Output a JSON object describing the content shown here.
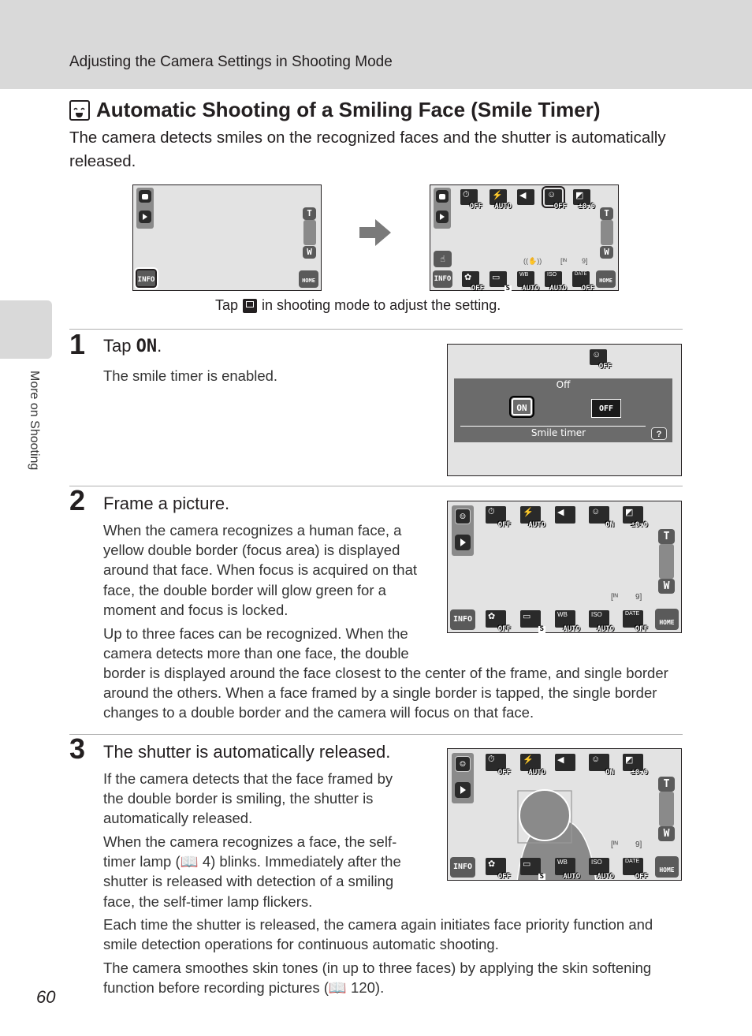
{
  "header": {
    "section": "Adjusting the Camera Settings in Shooting Mode"
  },
  "title": {
    "icon": "smile-timer-icon",
    "text": "Automatic Shooting of a Smiling Face (Smile Timer)"
  },
  "intro": "The camera detects smiles on the recognized faces and the shutter is automatically released.",
  "top_figure": {
    "caption_before": "Tap",
    "caption_icon": "smile-timer-icon",
    "caption_after": "in shooting mode to adjust the setting.",
    "screen_left": {
      "info": "INFO",
      "home": "HOME",
      "zoom_t": "T",
      "zoom_w": "W"
    },
    "screen_right": {
      "top_icons": [
        {
          "name": "self-timer",
          "sub": "OFF"
        },
        {
          "name": "flash",
          "sub": "AUTO"
        },
        {
          "name": "image-mode",
          "sub": ""
        },
        {
          "name": "smile-timer",
          "sub": "OFF"
        },
        {
          "name": "exposure-comp",
          "sub": "±0.0"
        }
      ],
      "bottom_icons": [
        {
          "name": "macro",
          "sub": "OFF"
        },
        {
          "name": "continuous",
          "sub": "S"
        },
        {
          "name": "white-balance",
          "glyph": "WB",
          "sub": "AUTO"
        },
        {
          "name": "iso",
          "glyph": "ISO",
          "sub": "AUTO"
        },
        {
          "name": "date",
          "glyph": "DATE",
          "sub": "OFF"
        }
      ],
      "info": "INFO",
      "home": "HOME",
      "zoom_t": "T",
      "zoom_w": "W",
      "status_vr": "((✋))",
      "status_memory": "[ᴵᴺ",
      "status_count": "9]"
    }
  },
  "steps": [
    {
      "number": "1",
      "title_before": "Tap",
      "title_bold": "ON",
      "title_after": ".",
      "paragraphs": [
        "The smile timer is enabled."
      ],
      "screen": {
        "current": "Off",
        "on_label": "ON",
        "off_label": "OFF",
        "menu_title": "Smile timer",
        "help": "?",
        "icon_sub": "OFF"
      }
    },
    {
      "number": "2",
      "title": "Frame a picture.",
      "paragraphs": [
        "When the camera recognizes a human face, a yellow double border (focus area) is displayed around that face. When focus is acquired on that face, the double border will glow green for a moment and focus is locked.",
        "Up to three faces can be recognized. When the camera detects more than one face, the double",
        "border is displayed around the face closest to the center of the frame, and single border around the others. When a face framed by a single border is tapped, the single border changes to a double border and the camera will focus on that face."
      ],
      "screen": {
        "top_icons": [
          {
            "name": "self-timer",
            "sub": "OFF"
          },
          {
            "name": "flash",
            "sub": "AUTO"
          },
          {
            "name": "image-mode",
            "sub": ""
          },
          {
            "name": "smile-timer",
            "sub": "ON"
          },
          {
            "name": "exposure-comp",
            "sub": "±0.0"
          }
        ],
        "bottom_icons": [
          {
            "name": "macro",
            "sub": "OFF"
          },
          {
            "name": "continuous",
            "sub": "S"
          },
          {
            "name": "white-balance",
            "glyph": "WB",
            "sub": "AUTO"
          },
          {
            "name": "iso",
            "glyph": "ISO",
            "sub": "AUTO"
          },
          {
            "name": "date",
            "glyph": "DATE",
            "sub": "OFF"
          }
        ],
        "info": "INFO",
        "home": "HOME",
        "zoom_t": "T",
        "zoom_w": "W",
        "status_memory": "[ᴵᴺ",
        "status_count": "9]"
      }
    },
    {
      "number": "3",
      "title": "The shutter is automatically released.",
      "paragraphs": [
        "If the camera detects that the face framed by the double border is smiling, the shutter is automatically released.",
        "When the camera recognizes a face, the self-timer lamp (📖 4) blinks. Immediately after the shutter is released with detection of a smiling face, the self-timer lamp flickers.",
        "Each time the shutter is released, the camera again initiates face priority function and smile detection operations for continuous automatic shooting.",
        "The camera smoothes skin tones (in up to three faces) by applying the skin softening function before recording pictures (📖 120)."
      ]
    }
  ],
  "side_tab": {
    "label": "More on Shooting"
  },
  "page_number": "60"
}
